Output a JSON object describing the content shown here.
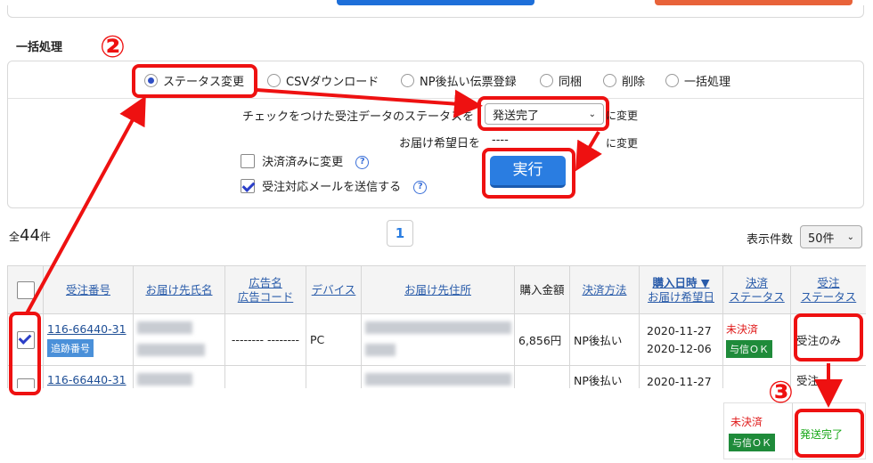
{
  "section": {
    "title": "一括処理"
  },
  "callouts": {
    "step2": "②",
    "step3": "③"
  },
  "options": [
    {
      "label": "ステータス変更",
      "selected": true
    },
    {
      "label": "CSVダウンロード",
      "selected": false
    },
    {
      "label": "NP後払い伝票登録",
      "selected": false
    },
    {
      "label": "同梱",
      "selected": false
    },
    {
      "label": "削除",
      "selected": false
    },
    {
      "label": "一括処理",
      "selected": false
    }
  ],
  "status_row": {
    "label": "チェックをつけた受注データのステータスを",
    "value": "発送完了",
    "suffix": "に変更"
  },
  "date_row": {
    "label": "お届け希望日を",
    "value": "----",
    "suffix": "に変更"
  },
  "checkbox_paid": {
    "label": "決済済みに変更",
    "checked": false
  },
  "checkbox_mail": {
    "label": "受注対応メールを送信する",
    "checked": true
  },
  "execute_label": "実行",
  "total": {
    "prefix": "全",
    "count": "44",
    "suffix": "件"
  },
  "pagination": {
    "current": "1"
  },
  "per_page": {
    "label": "表示件数",
    "value": "50件"
  },
  "table": {
    "headers": {
      "order_no": "受注番号",
      "name": "お届け先氏名",
      "ad_name": "広告名",
      "ad_code": "広告コード",
      "device": "デバイス",
      "address": "お届け先住所",
      "amount": "購入金額",
      "payment": "決済方法",
      "purchase_date": "購入日時 ▼",
      "delivery_date": "お届け希望日",
      "pay_status_1": "決済",
      "pay_status_2": "ステータス",
      "order_status_1": "受注",
      "order_status_2": "ステータス"
    },
    "rows": [
      {
        "checked": true,
        "order_no": "116-66440-31",
        "tag": "追跡番号",
        "ad": "-------- --------",
        "device": "PC",
        "amount": "6,856円",
        "payment": "NP後払い",
        "purchase_date": "2020-11-27",
        "delivery_date": "2020-12-06",
        "pay_status": "未決済",
        "pay_badge": "与信ＯＫ",
        "order_status": "受注のみ"
      },
      {
        "checked": false,
        "order_no": "116-66440-31",
        "payment": "NP後払い",
        "purchase_date": "2020-11-27",
        "order_status": "受注"
      }
    ]
  },
  "result_panel": {
    "pay_status": "未決済",
    "pay_badge": "与信ＯＫ",
    "order_status": "発送完了"
  },
  "colors": {
    "accent_red": "#ee1111",
    "execute_blue": "#2a7de1",
    "status_green": "#18a818"
  }
}
